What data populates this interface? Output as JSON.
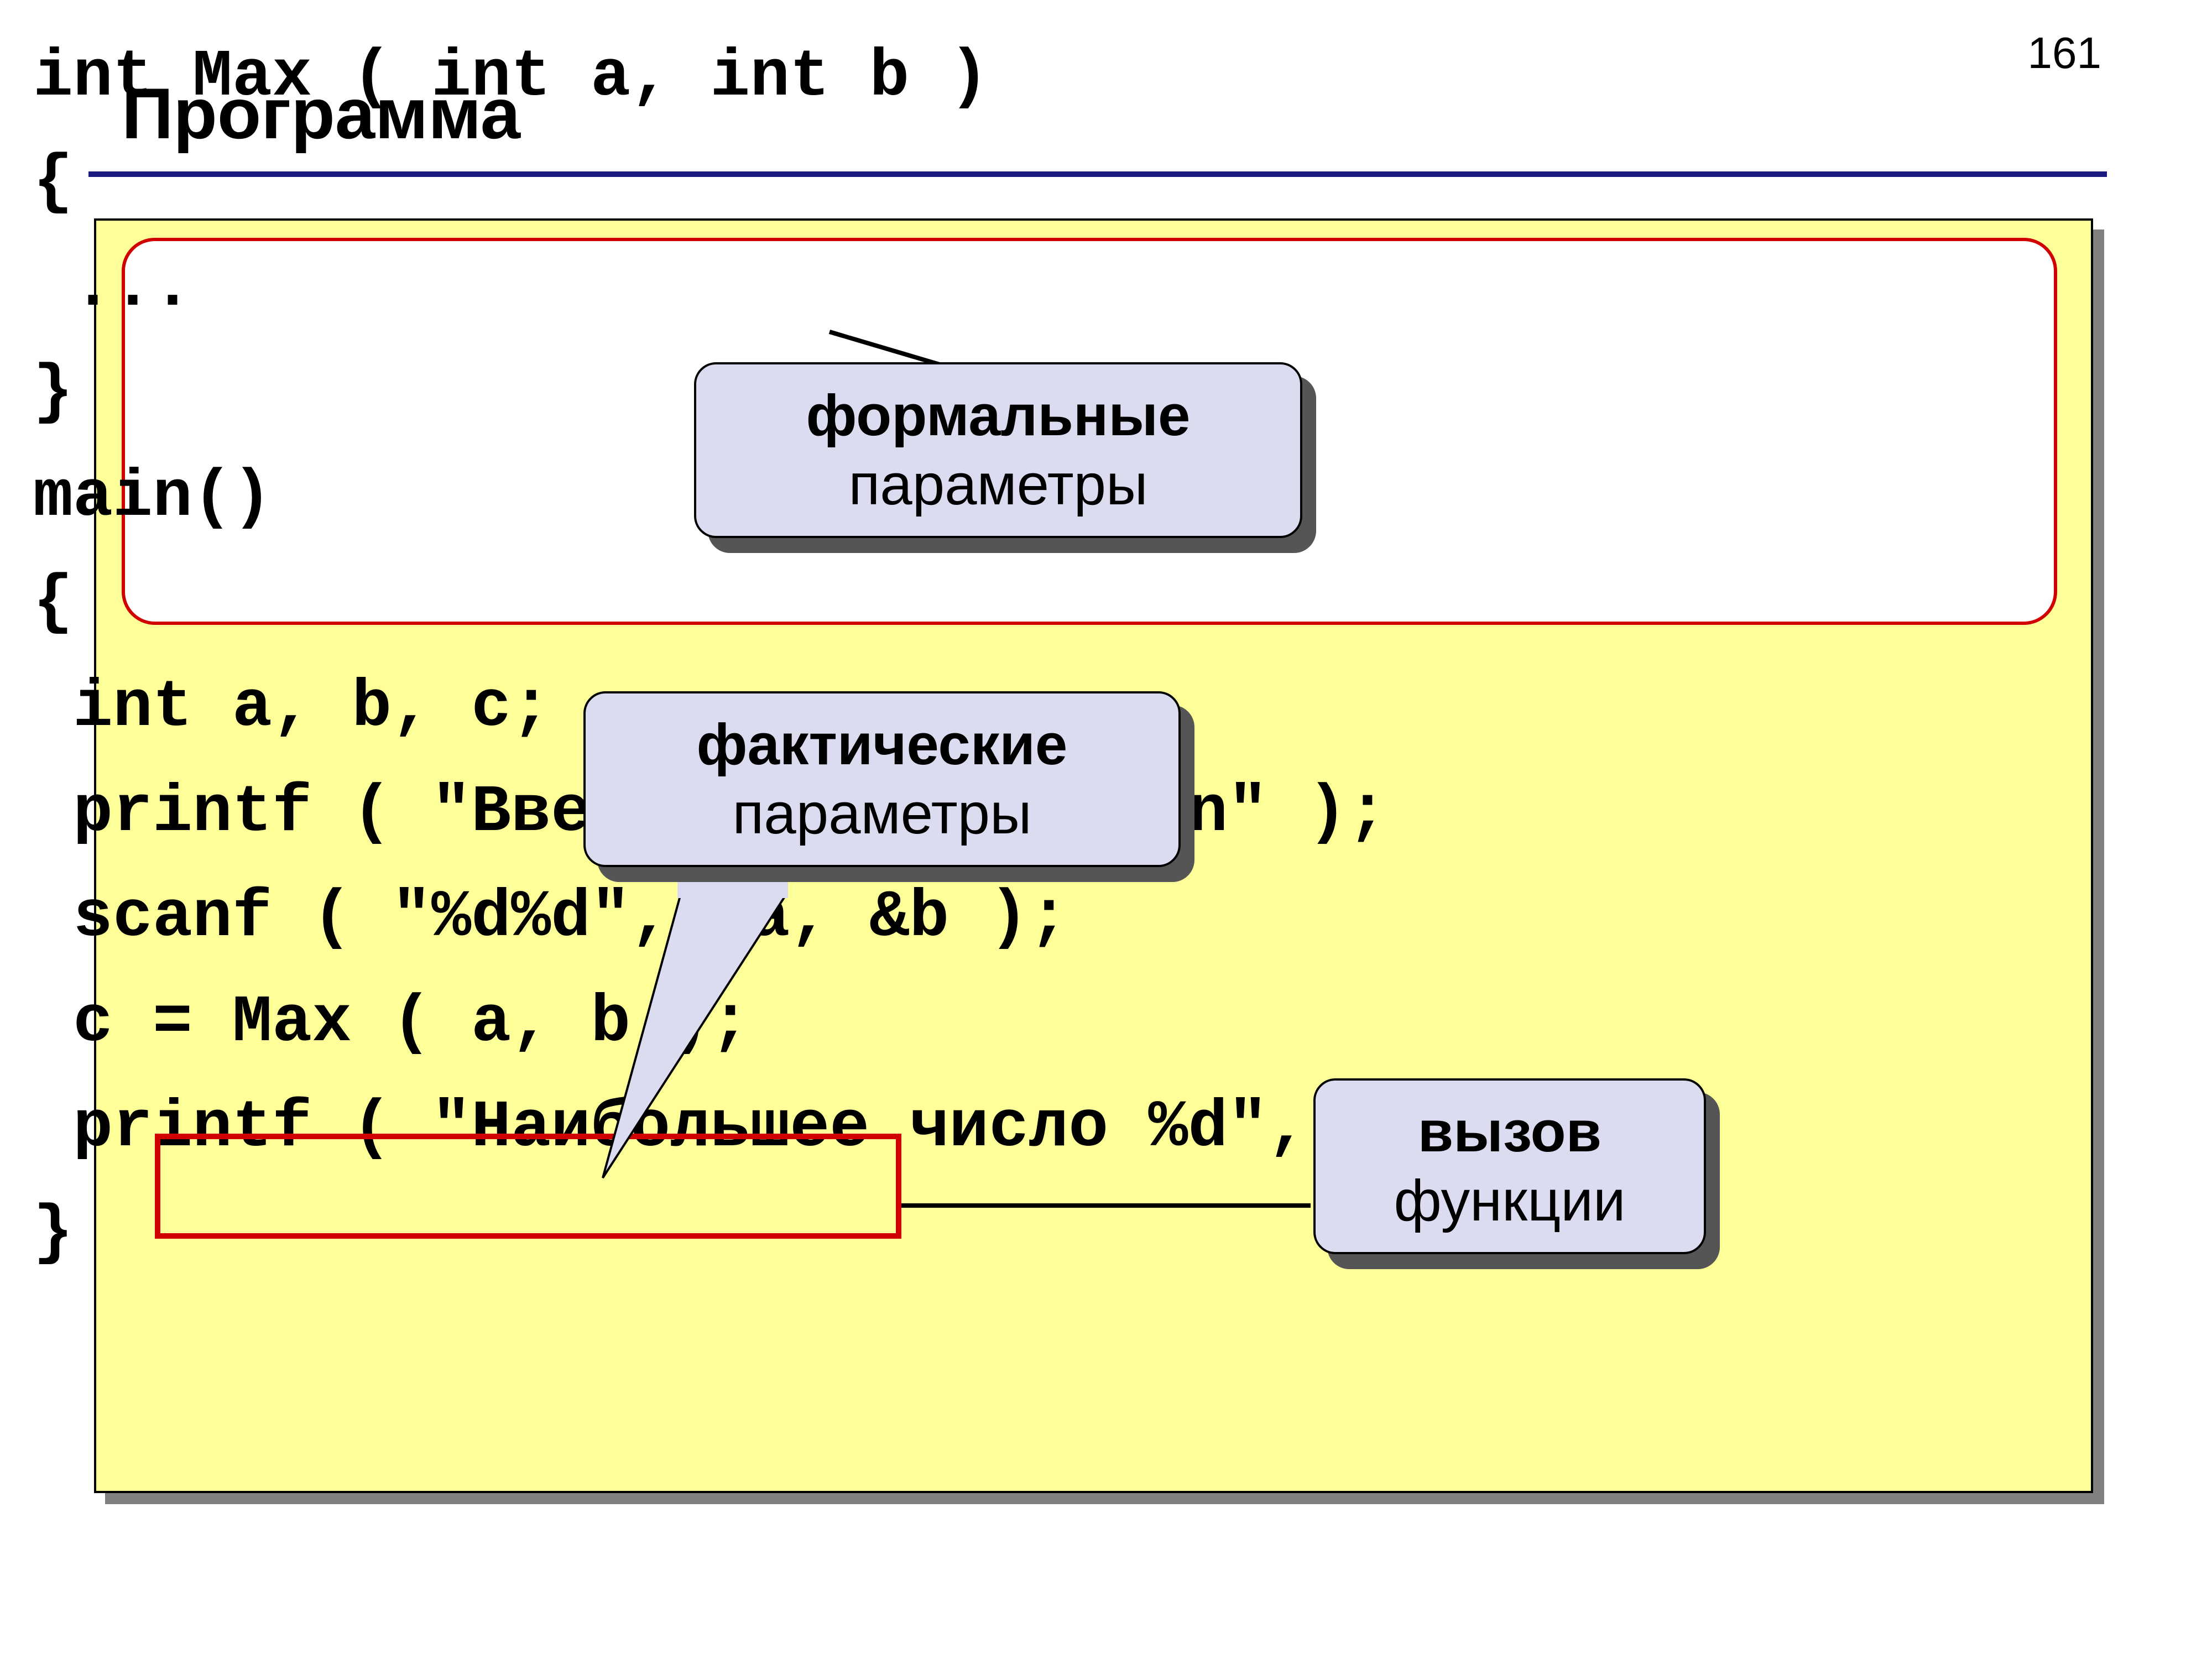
{
  "page_number": "161",
  "title": "Программа",
  "code_lines": {
    "l1": "int Max ( int a, int b )",
    "l2": "{",
    "l3": " ...",
    "l4": "}",
    "l5": "main()",
    "l6": "{",
    "l7": " int a, b, c;",
    "l8": " printf ( \"Введите два числа\\n\" );",
    "l9": " scanf ( \"%d%d\", &a, &b );",
    "l10": " c = Max ( a, b );",
    "l11": " printf ( \"Наибольшее число %d\", c );",
    "l12": "}"
  },
  "callouts": {
    "formal": {
      "bold": "формальные",
      "rest": "параметры"
    },
    "actual": {
      "bold": "фактические",
      "rest": "параметры"
    },
    "call": {
      "bold": "вызов",
      "rest": "функции"
    }
  }
}
